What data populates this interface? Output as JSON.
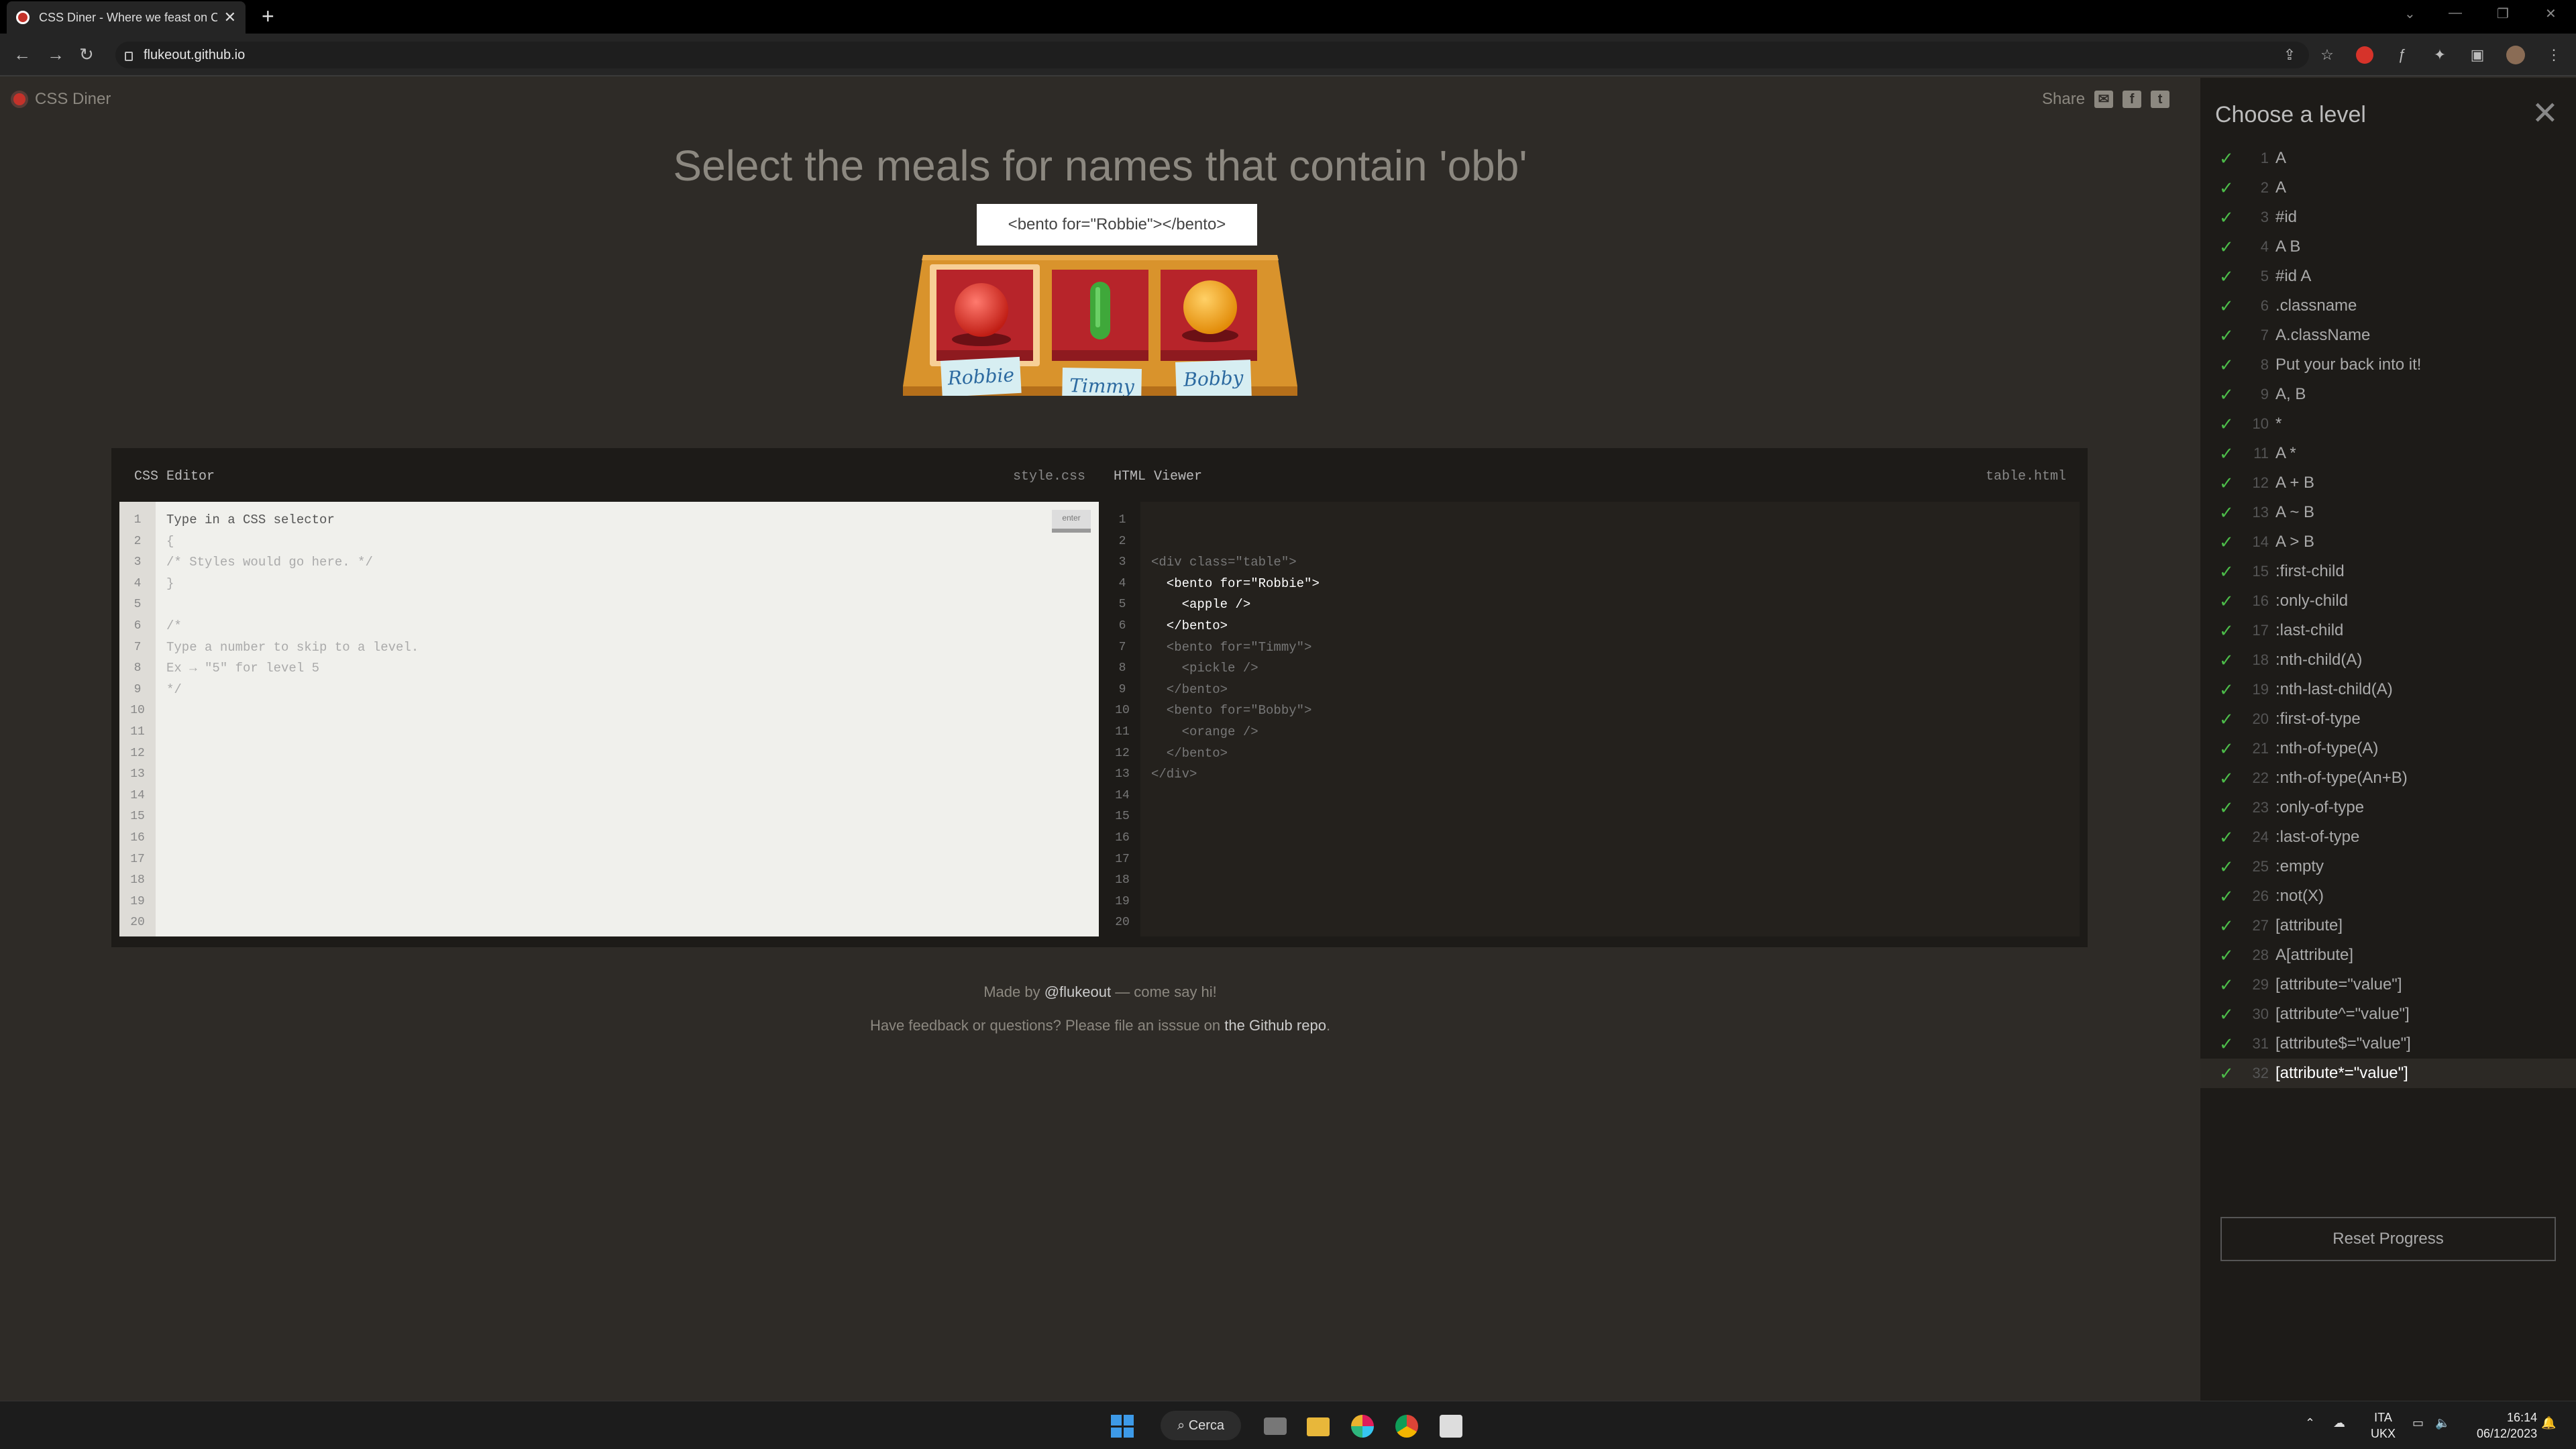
{
  "browser": {
    "tab_title": "CSS Diner - Where we feast on CSS Selectors!",
    "url": "flukeout.github.io",
    "new_tab": "+",
    "tab_close": "✕"
  },
  "app": {
    "logo_text": "CSS Diner",
    "share_label": "Share",
    "title": "Select the meals for names that contain 'obb'",
    "tooltip": "<bento for=\"Robbie\"></bento>",
    "plates": [
      {
        "name": "Robbie",
        "food": "apple"
      },
      {
        "name": "Timmy",
        "food": "pickle"
      },
      {
        "name": "Bobby",
        "food": "orange"
      }
    ]
  },
  "editor": {
    "css_title": "CSS Editor",
    "css_file": "style.css",
    "html_title": "HTML Viewer",
    "html_file": "table.html",
    "enter_label": "enter",
    "line_numbers": "1\n2\n3\n4\n5\n6\n7\n8\n9\n10\n11\n12\n13\n14\n15\n16\n17\n18\n19\n20",
    "css_input_placeholder": "Type in a CSS selector",
    "css_code": "{\n/* Styles would go here. */\n}\n\n/*\nType a number to skip to a level.\nEx → \"5\" for level 5\n*/",
    "html_lines": [
      {
        "text": "<div class=\"table\">",
        "highlight": false
      },
      {
        "text": "  <bento for=\"Robbie\">",
        "highlight": true
      },
      {
        "text": "    <apple />",
        "highlight": true
      },
      {
        "text": "  </bento>",
        "highlight": true
      },
      {
        "text": "  <bento for=\"Timmy\">",
        "highlight": false
      },
      {
        "text": "    <pickle />",
        "highlight": false
      },
      {
        "text": "  </bento>",
        "highlight": false
      },
      {
        "text": "  <bento for=\"Bobby\">",
        "highlight": false
      },
      {
        "text": "    <orange />",
        "highlight": false
      },
      {
        "text": "  </bento>",
        "highlight": false
      },
      {
        "text": "</div>",
        "highlight": false
      }
    ]
  },
  "footer": {
    "made_by_pre": "Made by ",
    "made_by_link": "@flukeout",
    "made_by_post": " — come say hi!",
    "feedback_pre": "Have feedback or questions? Please file an isssue on ",
    "feedback_link": "the Github repo",
    "feedback_post": "."
  },
  "sidebar": {
    "title": "Choose a level",
    "close": "✕",
    "levels": [
      {
        "num": "1",
        "name": "A"
      },
      {
        "num": "2",
        "name": "A"
      },
      {
        "num": "3",
        "name": "#id"
      },
      {
        "num": "4",
        "name": "A B"
      },
      {
        "num": "5",
        "name": "#id A"
      },
      {
        "num": "6",
        "name": ".classname"
      },
      {
        "num": "7",
        "name": "A.className"
      },
      {
        "num": "8",
        "name": "Put your back into it!"
      },
      {
        "num": "9",
        "name": "A, B"
      },
      {
        "num": "10",
        "name": "*"
      },
      {
        "num": "11",
        "name": "A *"
      },
      {
        "num": "12",
        "name": "A + B"
      },
      {
        "num": "13",
        "name": "A ~ B"
      },
      {
        "num": "14",
        "name": "A > B"
      },
      {
        "num": "15",
        "name": ":first-child"
      },
      {
        "num": "16",
        "name": ":only-child"
      },
      {
        "num": "17",
        "name": ":last-child"
      },
      {
        "num": "18",
        "name": ":nth-child(A)"
      },
      {
        "num": "19",
        "name": ":nth-last-child(A)"
      },
      {
        "num": "20",
        "name": ":first-of-type"
      },
      {
        "num": "21",
        "name": ":nth-of-type(A)"
      },
      {
        "num": "22",
        "name": ":nth-of-type(An+B)"
      },
      {
        "num": "23",
        "name": ":only-of-type"
      },
      {
        "num": "24",
        "name": ":last-of-type"
      },
      {
        "num": "25",
        "name": ":empty"
      },
      {
        "num": "26",
        "name": ":not(X)"
      },
      {
        "num": "27",
        "name": "[attribute]"
      },
      {
        "num": "28",
        "name": "A[attribute]"
      },
      {
        "num": "29",
        "name": "[attribute=\"value\"]"
      },
      {
        "num": "30",
        "name": "[attribute^=\"value\"]"
      },
      {
        "num": "31",
        "name": "[attribute$=\"value\"]"
      },
      {
        "num": "32",
        "name": "[attribute*=\"value\"]"
      }
    ],
    "current_level": "32",
    "reset_label": "Reset Progress"
  },
  "taskbar": {
    "search_label": "Cerca",
    "lang_1": "ITA",
    "lang_2": "UKX",
    "time": "16:14",
    "date": "06/12/2023"
  },
  "colors": {
    "background": "#2e2b27",
    "sidebar": "#1d1b18",
    "check": "#4cbb49",
    "apple": "#e02b20",
    "pickle": "#3fa83a",
    "orange": "#f5a51a"
  }
}
